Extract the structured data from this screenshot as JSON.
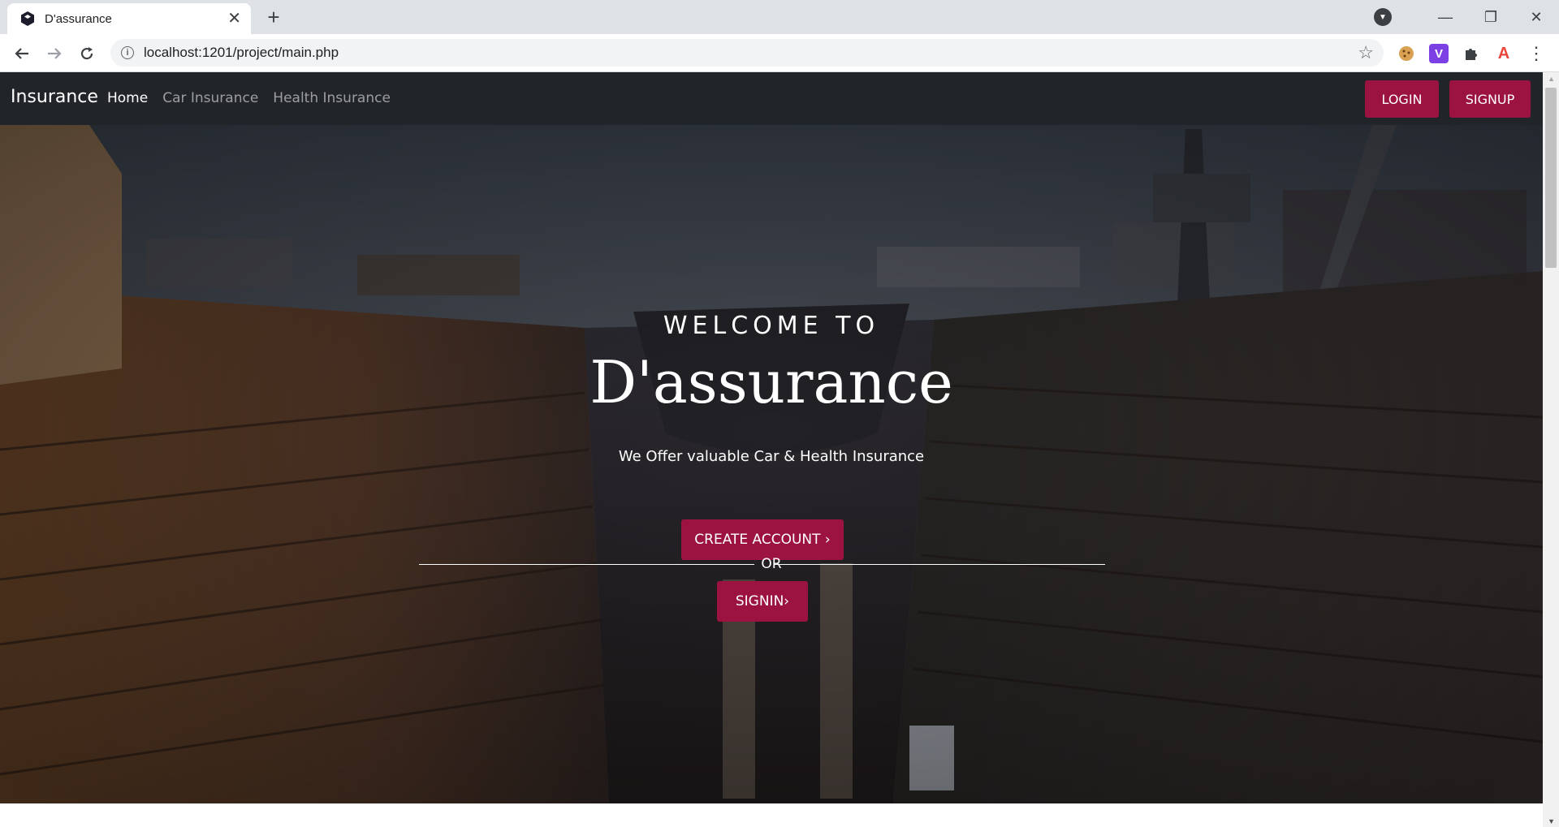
{
  "browser": {
    "tab_title": "D'assurance",
    "tab_close": "✕",
    "new_tab": "+",
    "url": "localhost:1201/project/main.php",
    "window_controls": [
      "—",
      "❐",
      "✕"
    ]
  },
  "navbar": {
    "brand": "Insurance",
    "links": [
      "Home",
      "Car Insurance",
      "Health Insurance"
    ],
    "login_label": "LOGIN",
    "signup_label": "SIGNUP"
  },
  "hero": {
    "welcome": "WELCOME TO",
    "headline": "D'assurance",
    "tagline": "We Offer valuable Car & Health Insurance",
    "create_account_label": "CREATE ACCOUNT ›",
    "or_label": "OR",
    "signin_label": "SIGNIN›"
  },
  "colors": {
    "navbar_bg": "#212529",
    "accent": "#9c1240",
    "tab_bar_bg": "#dee1e6"
  },
  "icons": {
    "back": "back-arrow-icon",
    "forward": "forward-arrow-icon",
    "reload": "reload-icon",
    "info": "site-info-icon",
    "bookmark": "star-icon",
    "extensions": [
      "cookie-icon",
      "vimeo-extension-icon",
      "puzzle-icon",
      "font-a-icon"
    ],
    "menu": "kebab-menu-icon"
  }
}
